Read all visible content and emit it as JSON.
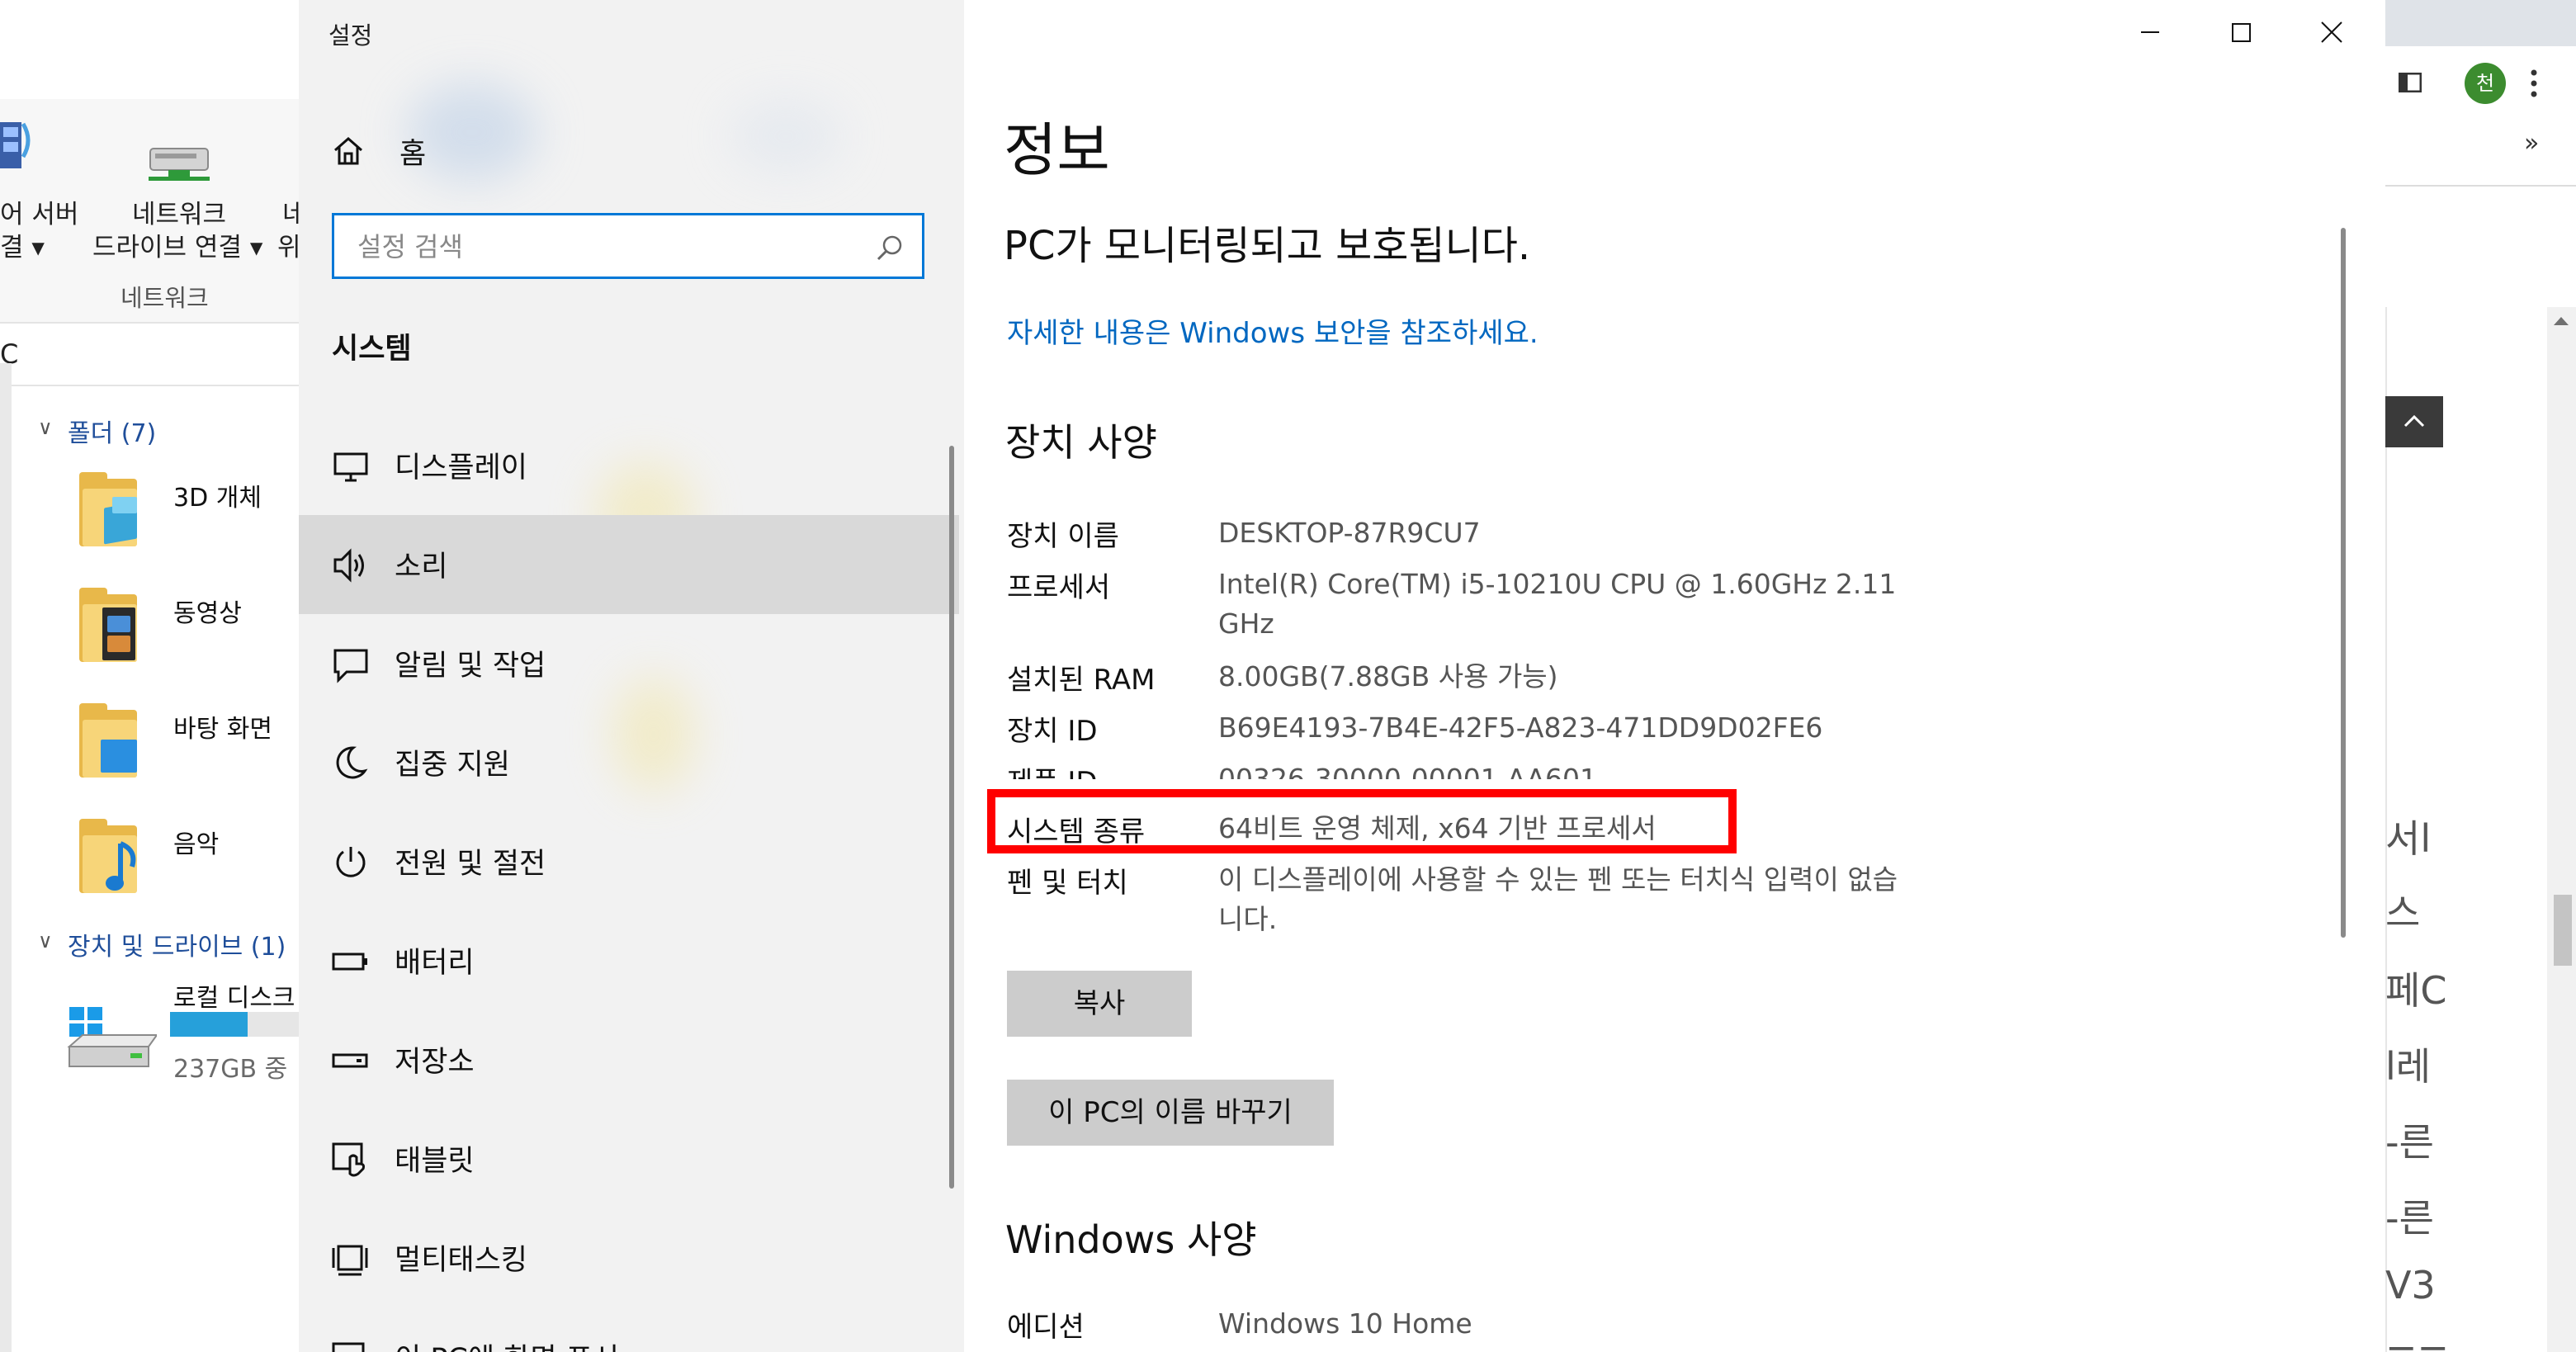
{
  "explorer": {
    "ribbon": {
      "button_media_server": "어 서버",
      "button_media_server_line2": "결 ▾",
      "button_network_drive": "네트워크",
      "button_network_drive_line2": "드라이브 연결 ▾",
      "button_partial_third": "네",
      "button_partial_third_line2": "위",
      "group_label": "네트워크"
    },
    "address_partial": "C",
    "folders_section": "폴더 (7)",
    "folders": [
      {
        "label": "3D 개체"
      },
      {
        "label": "동영상"
      },
      {
        "label": "바탕 화면"
      },
      {
        "label": "음악"
      }
    ],
    "drives_section": "장치 및 드라이브 (1)",
    "drive": {
      "label": "로컬 디스크",
      "usage": "237GB 중",
      "usage_fraction": 0.6
    }
  },
  "settings": {
    "app_title": "설정",
    "home_label": "홈",
    "search_placeholder": "설정 검색",
    "group_title": "시스템",
    "nav_items": [
      {
        "label": "디스플레이",
        "icon": "monitor-icon"
      },
      {
        "label": "소리",
        "icon": "speaker-icon",
        "selected": true
      },
      {
        "label": "알림 및 작업",
        "icon": "notification-icon"
      },
      {
        "label": "집중 지원",
        "icon": "moon-icon"
      },
      {
        "label": "전원 및 절전",
        "icon": "power-icon"
      },
      {
        "label": "배터리",
        "icon": "battery-icon"
      },
      {
        "label": "저장소",
        "icon": "storage-icon"
      },
      {
        "label": "태블릿",
        "icon": "tablet-icon"
      },
      {
        "label": "멀티태스킹",
        "icon": "multitasking-icon"
      },
      {
        "label": "이 PC에 화면 표시",
        "icon": "project-icon"
      }
    ],
    "content": {
      "page_title": "정보",
      "protect_status": "PC가 모니터링되고 보호됩니다.",
      "security_link": "자세한 내용은 Windows 보안을 참조하세요.",
      "device_spec_title": "장치 사양",
      "specs": [
        {
          "key": "장치 이름",
          "value": "DESKTOP-87R9CU7"
        },
        {
          "key": "프로세서",
          "value": "Intel(R) Core(TM) i5-10210U CPU @ 1.60GHz   2.11 GHz"
        },
        {
          "key": "설치된 RAM",
          "value": "8.00GB(7.88GB 사용 가능)"
        },
        {
          "key": "장치 ID",
          "value": "B69E4193-7B4E-42F5-A823-471DD9D02FE6"
        },
        {
          "key": "제품 ID",
          "value": "00326-30000-00001-AA601"
        },
        {
          "key": "시스템 종류",
          "value": "64비트 운영 체제, x64 기반 프로세서"
        },
        {
          "key": "펜 및 터치",
          "value": "이 디스플레이에 사용할 수 있는 펜 또는 터치식 입력이 없습니다."
        }
      ],
      "copy_button": "복사",
      "rename_button": "이 PC의 이름 바꾸기",
      "windows_spec_title": "Windows 사양",
      "edition_key": "에디션",
      "edition_value": "Windows 10 Home"
    }
  },
  "browser": {
    "avatar_initial": "천",
    "overflow": "»",
    "partial_texts": [
      "서l",
      "스",
      "페C",
      "l레",
      "-른",
      "-른",
      "V3",
      "=="
    ]
  },
  "colors": {
    "accent": "#0078d7",
    "link": "#0067c0",
    "highlight_box": "#ff0000",
    "nav_selected": "#d9d9d9"
  }
}
